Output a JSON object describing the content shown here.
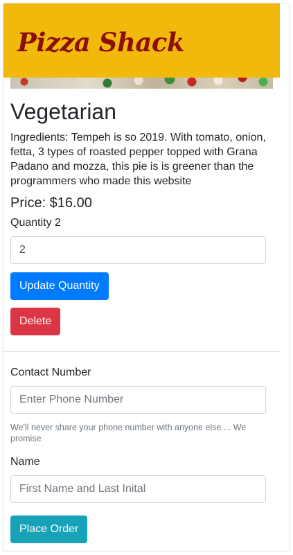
{
  "navbar": {
    "brand": "Pizza Shack"
  },
  "item": {
    "name": "Vegetarian",
    "ingredients": "Ingredients: Tempeh is so 2019. With tomato, onion, fetta, 3 types of roasted pepper topped with Grana Padano and mozza, this pie is is greener than the programmers who made this website",
    "price": "Price: $16.00",
    "quantity_label": "Quantity 2",
    "quantity_value": "2",
    "update_button": "Update Quantity",
    "delete_button": "Delete"
  },
  "order_form": {
    "contact_label": "Contact Number",
    "contact_placeholder": "Enter Phone Number",
    "contact_help": "We'll never share your phone number with anyone else.... We promise",
    "name_label": "Name",
    "name_placeholder": "First Name and Last Inital",
    "submit_button": "Place Order"
  },
  "colors": {
    "navbar_bg": "#f0b90b",
    "brand_text": "#8b0f07",
    "primary": "#007bff",
    "danger": "#dc3545",
    "info": "#17a2b8"
  }
}
